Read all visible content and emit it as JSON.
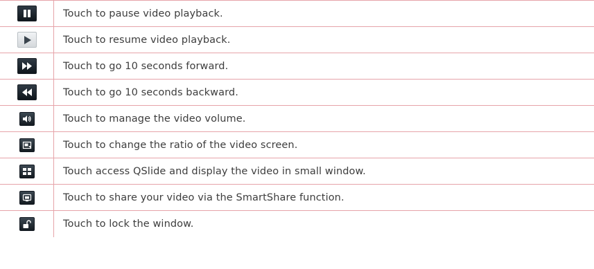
{
  "rows": [
    {
      "icon": "pause-icon",
      "text": "Touch to pause video playback."
    },
    {
      "icon": "play-icon",
      "text": "Touch to resume video playback."
    },
    {
      "icon": "fast-forward-icon",
      "text": "Touch to go 10 seconds forward."
    },
    {
      "icon": "rewind-icon",
      "text": "Touch to go 10 seconds backward."
    },
    {
      "icon": "volume-icon",
      "text": "Touch to manage the video volume."
    },
    {
      "icon": "screen-ratio-icon",
      "text": "Touch to change the ratio of the video screen."
    },
    {
      "icon": "qslide-icon",
      "text": "Touch access QSlide and display the video in small window."
    },
    {
      "icon": "smartshare-icon",
      "text": "Touch to share your video via the SmartShare function."
    },
    {
      "icon": "lock-icon",
      "text": "Touch to lock the window."
    }
  ],
  "colors": {
    "border": "#e6a3a9",
    "text": "#3d3d3d",
    "icon_dark": "#141b21"
  }
}
